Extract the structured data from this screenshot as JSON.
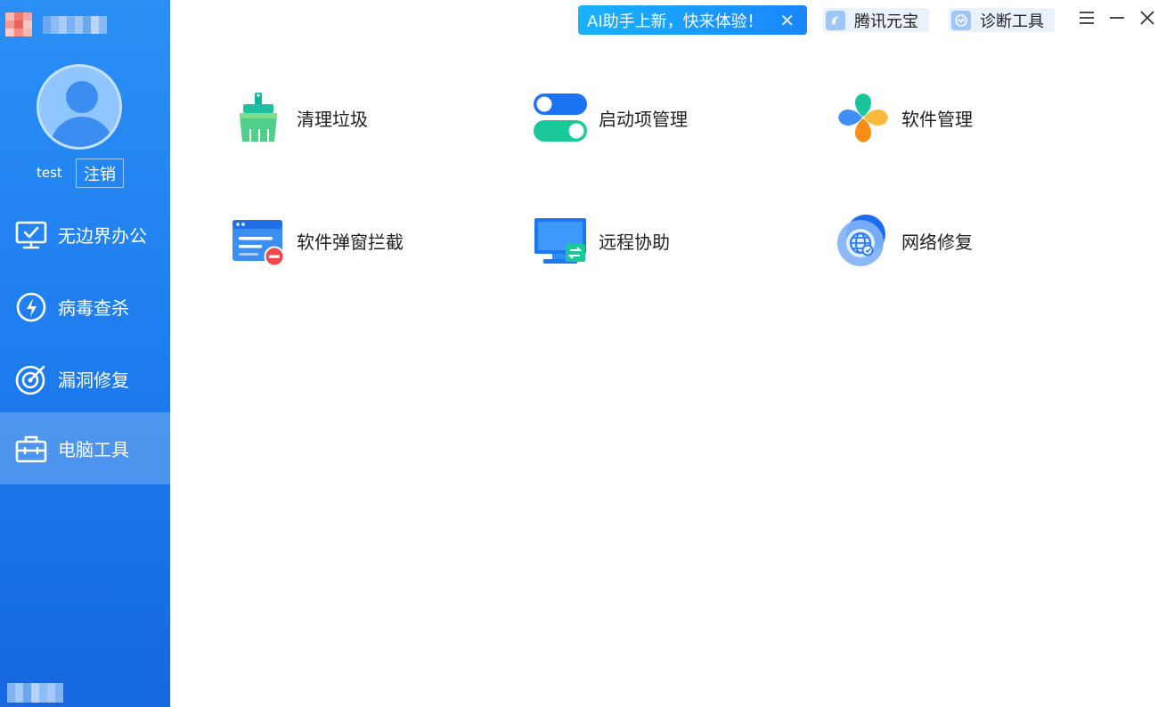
{
  "sidebar": {
    "username": "test",
    "logout_label": "注销",
    "items": [
      {
        "label": "无边界办公",
        "icon": "monitor-check-icon"
      },
      {
        "label": "病毒查杀",
        "icon": "lightning-shield-icon"
      },
      {
        "label": "漏洞修复",
        "icon": "target-icon"
      },
      {
        "label": "电脑工具",
        "icon": "toolbox-icon",
        "active": true
      }
    ]
  },
  "topbar": {
    "ai_banner": "AI助手上新，快来体验！",
    "yuanbao_label": "腾讯元宝",
    "diagnose_label": "诊断工具"
  },
  "tools": [
    {
      "label": "清理垃圾",
      "icon": "broom-icon"
    },
    {
      "label": "启动项管理",
      "icon": "toggle-switches-icon"
    },
    {
      "label": "软件管理",
      "icon": "clover-icon"
    },
    {
      "label": "软件弹窗拦截",
      "icon": "popup-block-icon"
    },
    {
      "label": "远程协助",
      "icon": "remote-monitor-icon"
    },
    {
      "label": "网络修复",
      "icon": "globe-repair-icon"
    }
  ],
  "colors": {
    "sidebar_top": "#2b8ff5",
    "sidebar_bottom": "#1667e0",
    "accent": "#1a86ff"
  }
}
